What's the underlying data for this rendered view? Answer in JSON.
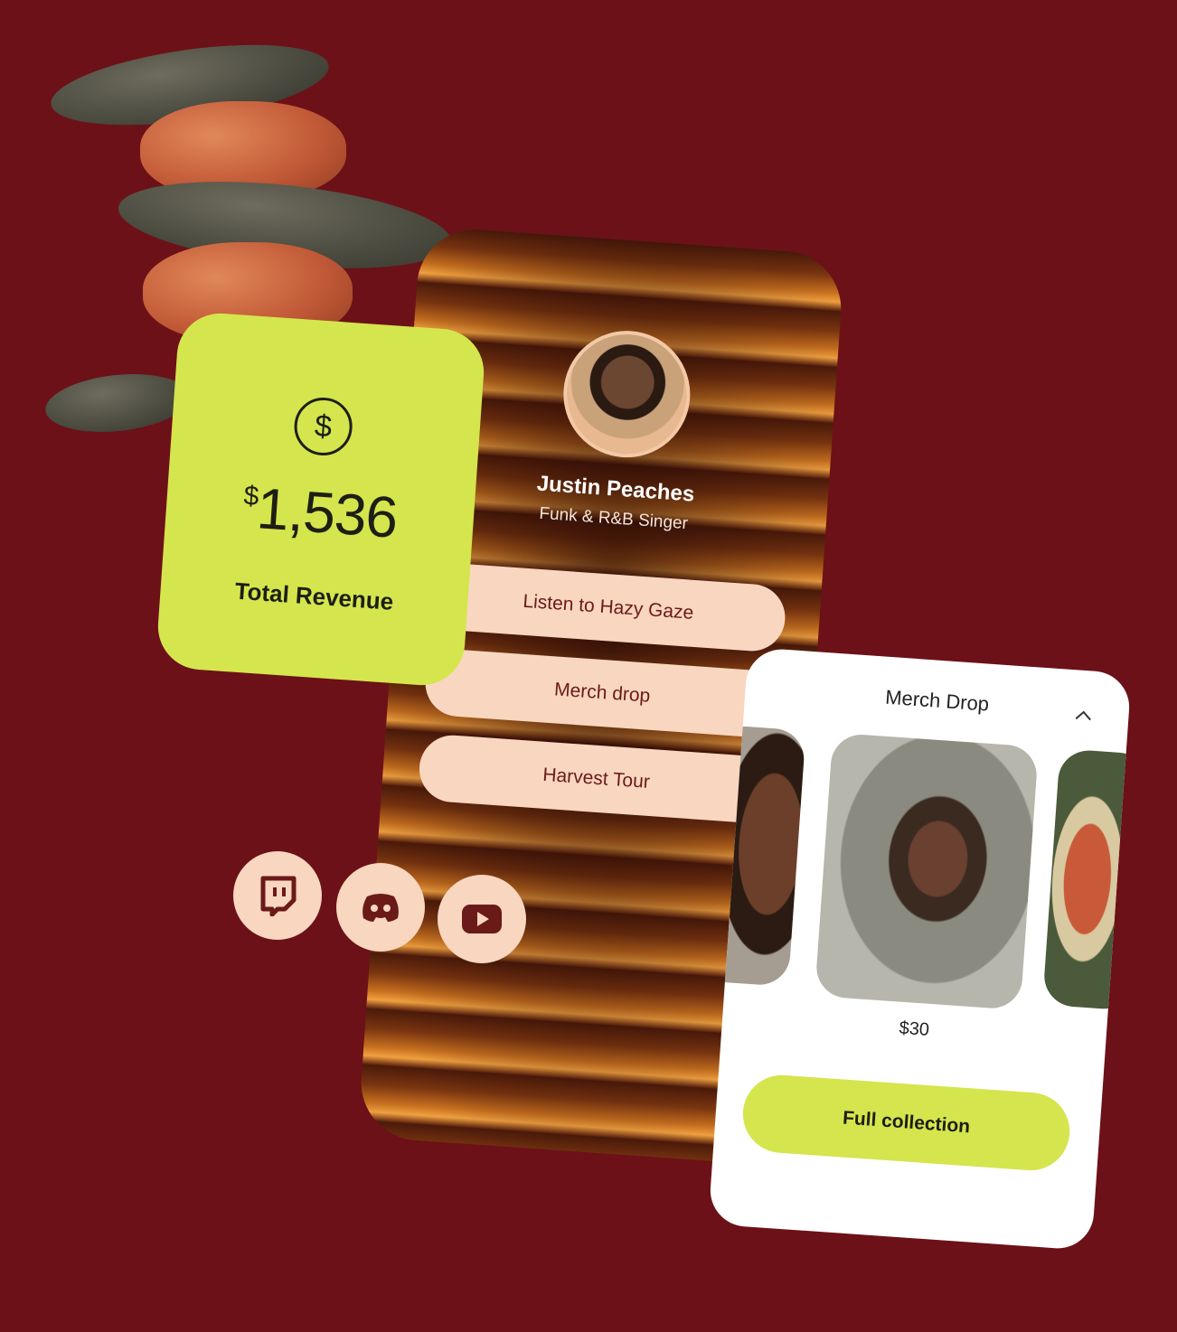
{
  "profile": {
    "name": "Justin Peaches",
    "subtitle": "Funk & R&B Singer",
    "links": [
      {
        "label": "Listen to Hazy Gaze"
      },
      {
        "label": "Merch drop"
      },
      {
        "label": "Harvest Tour"
      }
    ]
  },
  "revenue": {
    "currency_symbol": "$",
    "amount": "1,536",
    "label": "Total Revenue",
    "icon": "dollar-circle-icon"
  },
  "social": [
    {
      "icon": "twitch-icon"
    },
    {
      "icon": "discord-icon"
    },
    {
      "icon": "youtube-icon"
    }
  ],
  "merch": {
    "title": "Merch Drop",
    "price": "$30",
    "button_label": "Full collection",
    "collapse_icon": "chevron-up-icon"
  },
  "colors": {
    "background": "#6c1118",
    "accent_lime": "#d5e54d",
    "button_peach": "#f8d6c0"
  }
}
